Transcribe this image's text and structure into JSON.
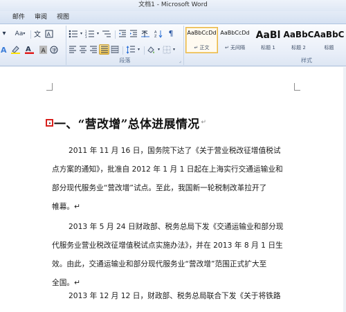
{
  "window": {
    "title": "文档1 - Microsoft Word"
  },
  "tabs": [
    {
      "label": "邮件"
    },
    {
      "label": "审阅"
    },
    {
      "label": "视图"
    }
  ],
  "ribbon": {
    "font_size_label": "Aa",
    "paragraph_group_label": "段落",
    "styles_group_label": "样式",
    "styles": [
      {
        "sample": "AaBbCcDd",
        "name": "↵ 正文",
        "selected": true
      },
      {
        "sample": "AaBbCcDd",
        "name": "↵ 无间隔",
        "selected": false
      },
      {
        "sample": "AaBl",
        "name": "标题 1",
        "selected": false
      },
      {
        "sample": "AaBbC",
        "name": "标题 2",
        "selected": false
      },
      {
        "sample": "AaBbC",
        "name": "标题",
        "selected": false
      }
    ]
  },
  "document": {
    "heading": "一、“营改增”总体进展情况",
    "paragraph_mark": "↵",
    "paragraphs": [
      {
        "lines": [
          "2011 年 11 月 16 日，国务院下达了《关于营业税改征增值税试",
          "点方案的通知》，批准自 2012 年 1 月 1 日起在上海实行交通运输业和",
          "部分现代服务业“营改增”试点。至此，我国新一轮税制改革拉开了",
          "帷幕。↵"
        ]
      },
      {
        "lines": [
          "2013 年 5 月 24 日财政部、税务总局下发《交通运输业和部分现",
          "代服务业营业税改征增值税试点实施办法》，并在 2013 年 8 月 1 日生",
          "效。由此，交通运输业和部分现代服务业“营改增”范围正式扩大至",
          "全国。↵"
        ]
      },
      {
        "lines": [
          "2013 年 12 月 12 日，财政部、税务总局联合下发《关于将铁路"
        ]
      }
    ]
  },
  "colors": {
    "heading_marker": "#d8201c",
    "style_selected_border": "#e8b445",
    "active_button": "#f7c94d"
  }
}
